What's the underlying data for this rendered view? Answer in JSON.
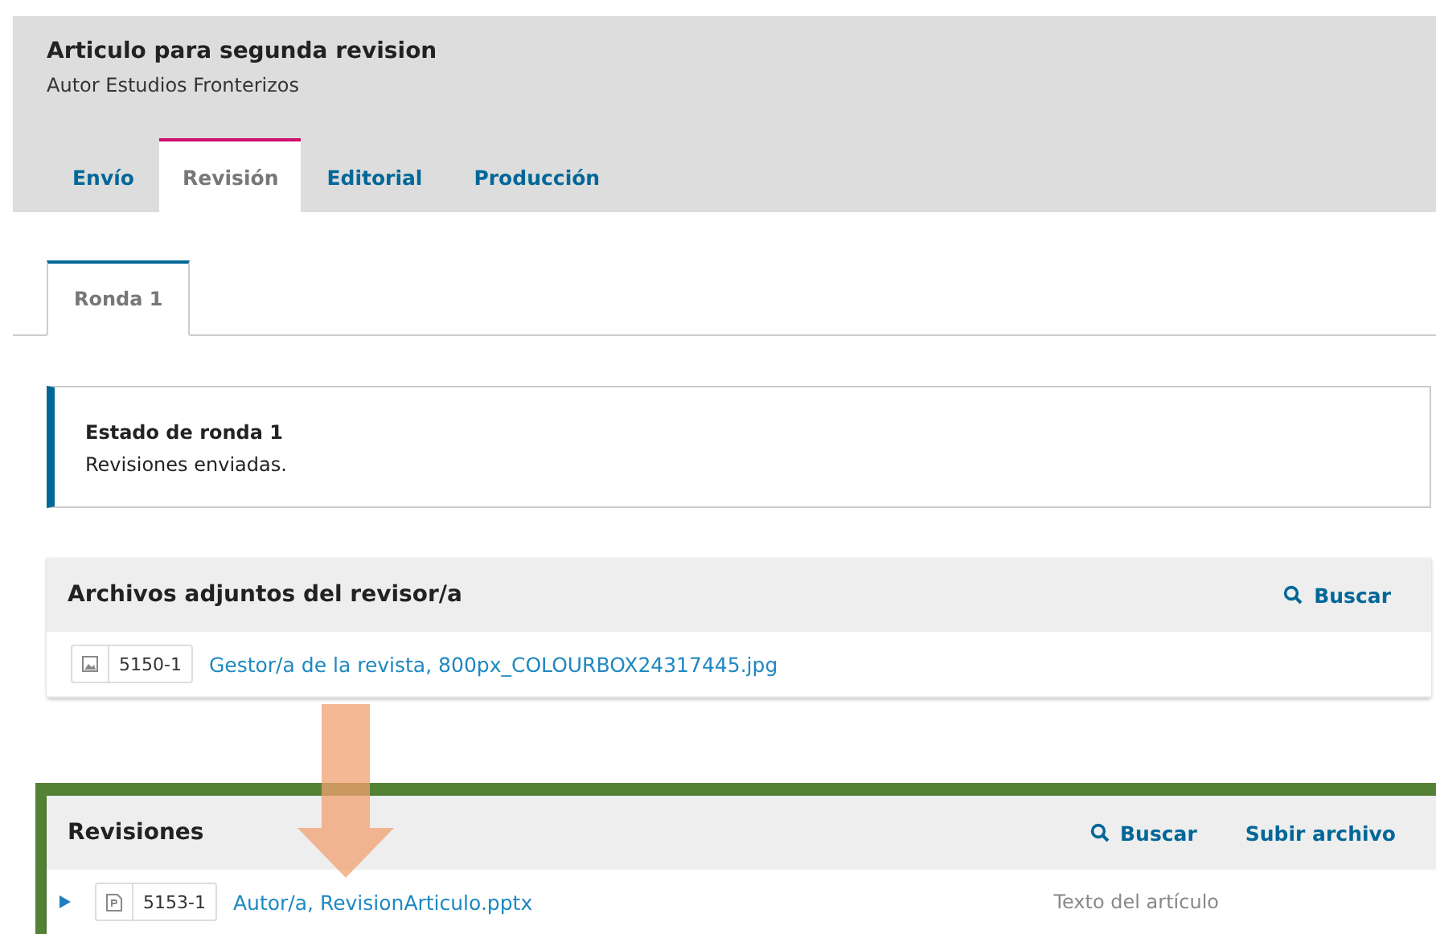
{
  "submission": {
    "title": "Articulo para segunda revision",
    "author": "Autor Estudios Fronterizos"
  },
  "tabs": [
    {
      "label": "Envío",
      "selected": false
    },
    {
      "label": "Revisión",
      "selected": true
    },
    {
      "label": "Editorial",
      "selected": false
    },
    {
      "label": "Producción",
      "selected": false
    }
  ],
  "round_tabs": [
    {
      "label": "Ronda 1",
      "selected": true
    }
  ],
  "round_status": {
    "title": "Estado de ronda 1",
    "text": "Revisiones enviadas."
  },
  "reviewer_files": {
    "title": "Archivos adjuntos del revisor/a",
    "highlighted": false,
    "actions": [
      {
        "kind": "search",
        "label": "Buscar"
      }
    ],
    "files": [
      {
        "kind": "image",
        "id": "5150-1",
        "name": "Gestor/a de la revista, 800px_COLOURBOX24317445.jpg",
        "expandable": false
      }
    ]
  },
  "revisions": {
    "title": "Revisiones",
    "highlighted": true,
    "actions": [
      {
        "kind": "search",
        "label": "Buscar"
      },
      {
        "kind": "upload",
        "label": "Subir archivo"
      }
    ],
    "files": [
      {
        "kind": "document",
        "id": "5153-1",
        "name": "Autor/a, RevisionArticulo.pptx",
        "expandable": true,
        "expanded": false,
        "type": "Texto del artículo"
      }
    ]
  },
  "annotation": {
    "kind": "arrow"
  }
}
